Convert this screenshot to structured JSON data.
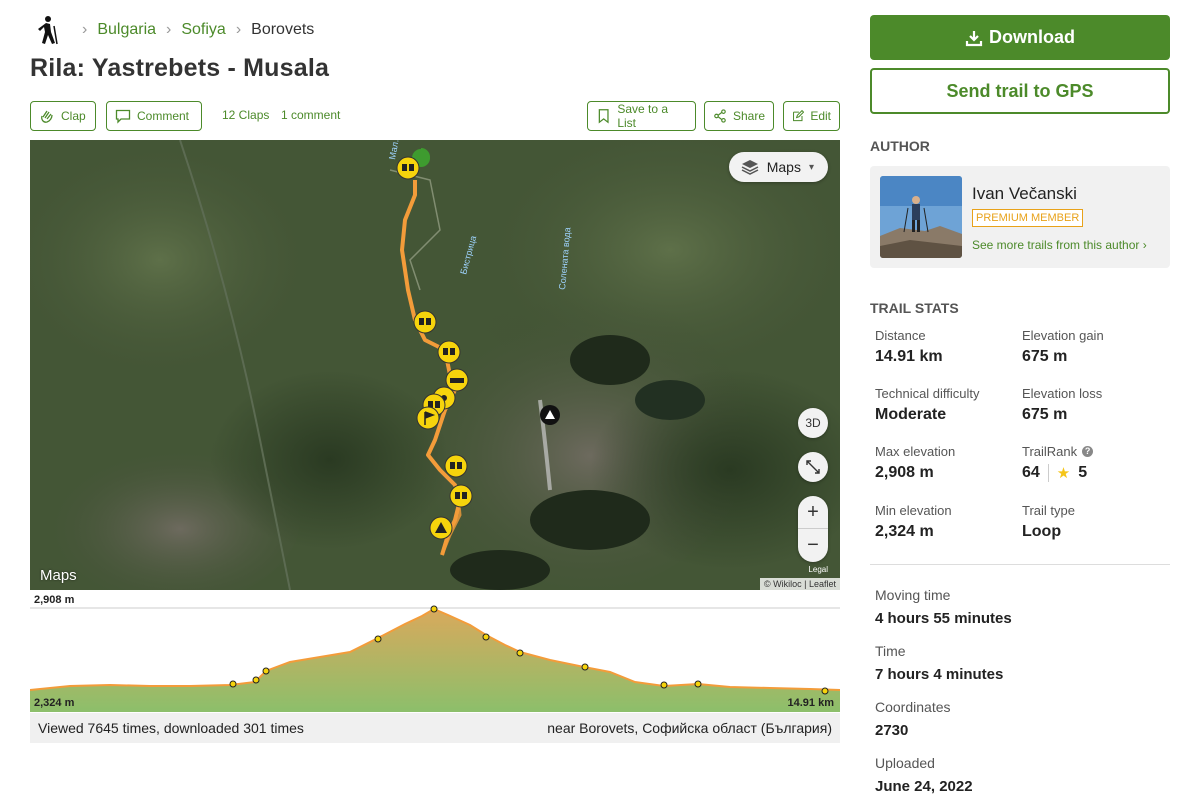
{
  "breadcrumb": {
    "icon": "hiker-icon",
    "items": [
      "Bulgaria",
      "Sofiya",
      "Borovets"
    ]
  },
  "title": "Rila: Yastrebets - Musala",
  "actions": {
    "clap": "Clap",
    "comment": "Comment",
    "claps_count": "12 Claps",
    "comments_count": "1 comment",
    "save": "Save to a List",
    "share": "Share",
    "edit": "Edit"
  },
  "map": {
    "layers_label": "Maps",
    "btn_3d": "3D",
    "zoom_in": "+",
    "zoom_out": "−",
    "brand": "Maps",
    "legal": "Legal",
    "attribution": "© Wikiloc | Leaflet",
    "river_labels": [
      "Мал...",
      "Бистрица",
      "Солената вода"
    ]
  },
  "elevation": {
    "max": "2,908 m",
    "min": "2,324 m",
    "distance": "14.91 km"
  },
  "footer": {
    "views": "Viewed 7645 times, downloaded 301 times",
    "near": "near Borovets, Софийска област (България)"
  },
  "sidebar": {
    "download": "Download",
    "send_gps": "Send trail to GPS",
    "author_heading": "AUTHOR",
    "author_name": "Ivan Večanski",
    "premium": "PREMIUM MEMBER",
    "author_link": "See more trails from this author ›",
    "stats_heading": "TRAIL STATS"
  },
  "stats": {
    "distance_label": "Distance",
    "distance": "14.91 km",
    "gain_label": "Elevation gain",
    "gain": "675 m",
    "difficulty_label": "Technical difficulty",
    "difficulty": "Moderate",
    "loss_label": "Elevation loss",
    "loss": "675 m",
    "max_label": "Max elevation",
    "max": "2,908 m",
    "rank_label": "TrailRank",
    "rank": "64",
    "rating": "5",
    "min_label": "Min elevation",
    "min": "2,324 m",
    "type_label": "Trail type",
    "type": "Loop",
    "moving_label": "Moving time",
    "moving": "4 hours 55 minutes",
    "time_label": "Time",
    "time": "7 hours 4 minutes",
    "coords_label": "Coordinates",
    "coords": "2730",
    "uploaded_label": "Uploaded",
    "uploaded": "June 24, 2022"
  },
  "colors": {
    "brand_green": "#4c8a2a",
    "route_orange": "#f39c3a",
    "waypoint_yellow": "#f6d40c",
    "premium_orange": "#e8a21a"
  }
}
